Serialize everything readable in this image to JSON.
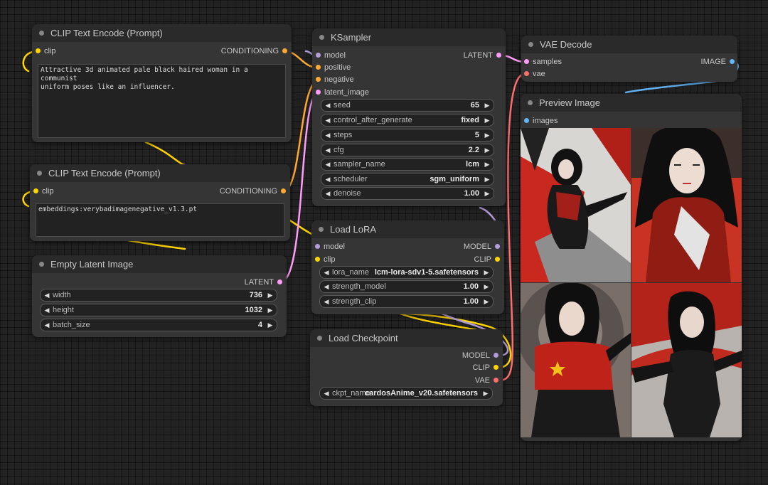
{
  "nodes": {
    "clip_pos": {
      "title": "CLIP Text Encode (Prompt)",
      "input_clip": "clip",
      "output": "CONDITIONING",
      "text": "Attractive 3d animated pale black haired woman in a communist\nuniform poses like an influencer."
    },
    "clip_neg": {
      "title": "CLIP Text Encode (Prompt)",
      "input_clip": "clip",
      "output": "CONDITIONING",
      "text": "embeddings:verybadimagenegative_v1.3.pt"
    },
    "empty_latent": {
      "title": "Empty Latent Image",
      "output": "LATENT",
      "widgets": [
        {
          "name": "width",
          "value": "736"
        },
        {
          "name": "height",
          "value": "1032"
        },
        {
          "name": "batch_size",
          "value": "4"
        }
      ]
    },
    "ksampler": {
      "title": "KSampler",
      "inputs": [
        "model",
        "positive",
        "negative",
        "latent_image"
      ],
      "output": "LATENT",
      "widgets": [
        {
          "name": "seed",
          "value": "65"
        },
        {
          "name": "control_after_generate",
          "value": "fixed"
        },
        {
          "name": "steps",
          "value": "5"
        },
        {
          "name": "cfg",
          "value": "2.2"
        },
        {
          "name": "sampler_name",
          "value": "lcm"
        },
        {
          "name": "scheduler",
          "value": "sgm_uniform"
        },
        {
          "name": "denoise",
          "value": "1.00"
        }
      ]
    },
    "load_lora": {
      "title": "Load LoRA",
      "inputs": [
        "model",
        "clip"
      ],
      "outputs": [
        "MODEL",
        "CLIP"
      ],
      "widgets": [
        {
          "name": "lora_name",
          "value": "lcm-lora-sdv1-5.safetensors"
        },
        {
          "name": "strength_model",
          "value": "1.00"
        },
        {
          "name": "strength_clip",
          "value": "1.00"
        }
      ]
    },
    "load_checkpoint": {
      "title": "Load Checkpoint",
      "outputs": [
        "MODEL",
        "CLIP",
        "VAE"
      ],
      "widgets": [
        {
          "name": "ckpt_name",
          "value": "cardosAnime_v20.safetensors"
        }
      ]
    },
    "vae_decode": {
      "title": "VAE Decode",
      "inputs": [
        "samples",
        "vae"
      ],
      "output": "IMAGE"
    },
    "preview_image": {
      "title": "Preview Image",
      "input": "images"
    }
  },
  "colors": {
    "model": "#b39ddb",
    "conditioning": "#ffa931",
    "latent": "#ff9cf9",
    "clip": "#ffd500",
    "vae": "#ff6e6e",
    "image": "#64b5f6",
    "node_bg": "#353535",
    "title_bg": "#2a2a2a"
  },
  "preview_images": [
    {
      "name": "generated-image-1",
      "icon": "anime-woman-red-uniform"
    },
    {
      "name": "generated-image-2",
      "icon": "anime-woman-red-shirt"
    },
    {
      "name": "generated-image-3",
      "icon": "anime-woman-red-jacket-star"
    },
    {
      "name": "generated-image-4",
      "icon": "anime-woman-black-uniform"
    }
  ]
}
